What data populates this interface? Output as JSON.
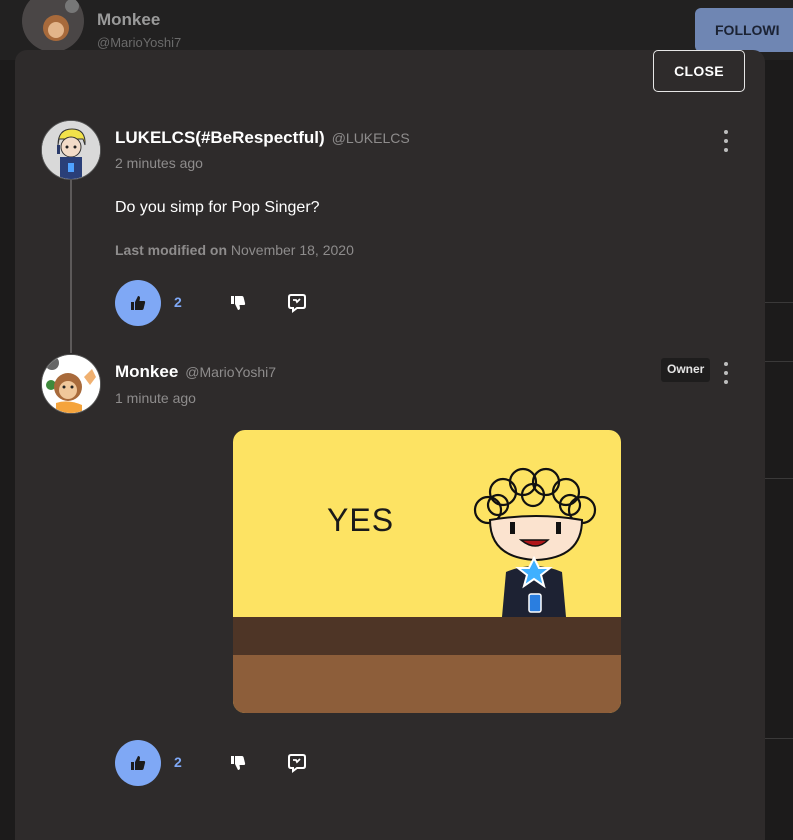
{
  "background_profile": {
    "name": "Monkee",
    "handle": "@MarioYoshi7",
    "follow_label": "FOLLOWI"
  },
  "modal": {
    "close_label": "CLOSE",
    "comments": [
      {
        "author": "LUKELCS(#BeRespectful)",
        "handle": "@LUKELCS",
        "time": "2 minutes ago",
        "text": "Do you simp for Pop Singer?",
        "modified_label": "Last modified on",
        "modified_date": "November 18, 2020",
        "likes": "2",
        "icons": {
          "like": "thumbs-up-icon",
          "dislike": "thumbs-down-icon",
          "reply": "reply-icon",
          "menu": "more-vertical-icon"
        }
      },
      {
        "author": "Monkee",
        "handle": "@MarioYoshi7",
        "time": "1 minute ago",
        "badge": "Owner",
        "gif_text": "YES",
        "likes": "2",
        "icons": {
          "like": "thumbs-up-icon",
          "dislike": "thumbs-down-icon",
          "reply": "reply-icon",
          "menu": "more-vertical-icon"
        }
      }
    ]
  },
  "colors": {
    "accent": "#7fa8f5",
    "modal_bg": "#2e2b2b",
    "page_bg": "#1c1b1b",
    "gif_yellow": "#fde363"
  }
}
